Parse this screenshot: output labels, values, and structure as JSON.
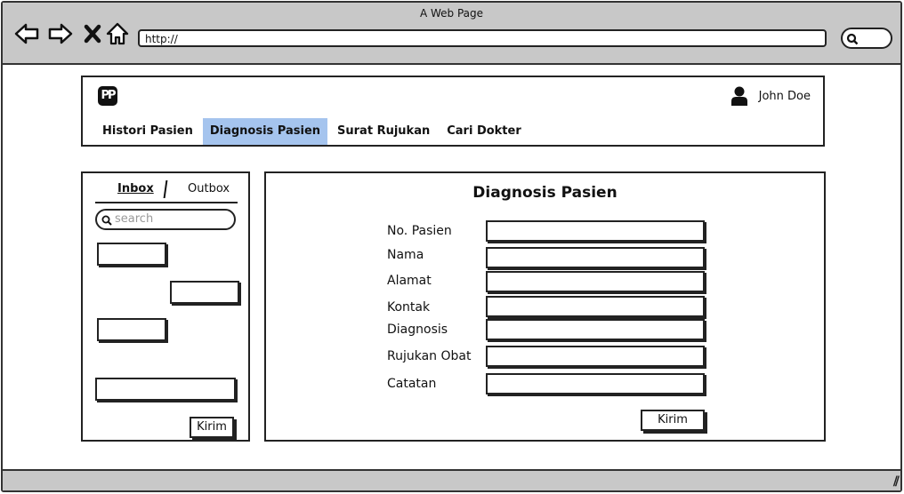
{
  "window": {
    "title": "A Web Page"
  },
  "browser": {
    "url": "http://"
  },
  "header": {
    "logo_text": "PP",
    "user_name": "John Doe",
    "menu": [
      {
        "label": "Histori Pasien",
        "active": false
      },
      {
        "label": "Diagnosis Pasien",
        "active": true
      },
      {
        "label": "Surat Rujukan",
        "active": false
      },
      {
        "label": "Cari Dokter",
        "active": false
      }
    ]
  },
  "sidebar": {
    "tab_inbox": "Inbox",
    "tab_outbox": "Outbox",
    "search_placeholder": "search",
    "send_label": "Kirim"
  },
  "form": {
    "title": "Diagnosis Pasien",
    "fields": [
      {
        "label": "No. Pasien",
        "value": ""
      },
      {
        "label": "Nama",
        "value": ""
      },
      {
        "label": "Alamat",
        "value": ""
      },
      {
        "label": "Kontak",
        "value": ""
      },
      {
        "label": "Diagnosis",
        "value": ""
      },
      {
        "label": "Rujukan Obat",
        "value": ""
      },
      {
        "label": "Catatan",
        "value": ""
      }
    ],
    "submit_label": "Kirim"
  },
  "colors": {
    "active_menu": "#a5c4ee",
    "chrome": "#c8c8c8"
  }
}
